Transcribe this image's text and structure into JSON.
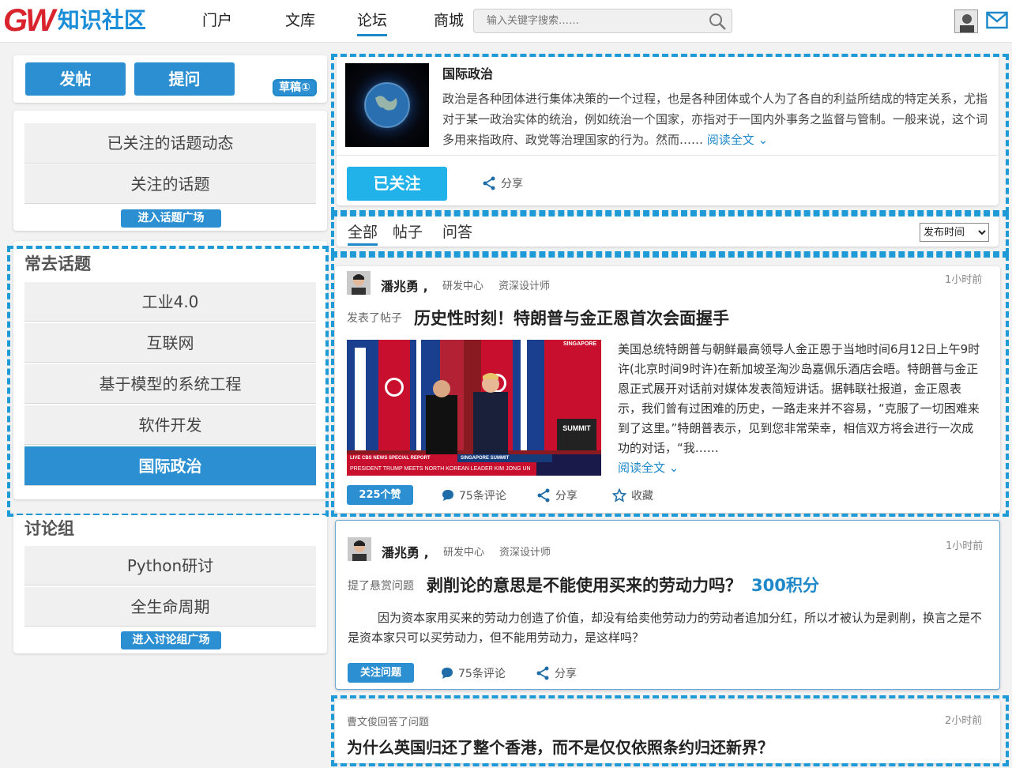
{
  "header": {
    "logo_mark": "GW",
    "logo_text": "知识社区",
    "nav": [
      "门户",
      "文库",
      "论坛",
      "商城"
    ],
    "active_nav": 2,
    "search_placeholder": "输入关键字搜索……"
  },
  "sidebar": {
    "post_button": "发帖",
    "ask_button": "提问",
    "draft_label": "草稿①",
    "followed_items": [
      "已关注的话题动态",
      "关注的话题"
    ],
    "topic_square": "进入话题广场",
    "frequent_title": "常去话题",
    "frequent_items": [
      "工业4.0",
      "互联网",
      "基于模型的系统工程",
      "软件开发",
      "国际政治"
    ],
    "active_frequent": 4,
    "groups_title": "讨论组",
    "group_items": [
      "Python研讨",
      "全生命周期"
    ],
    "group_square": "进入讨论组广场"
  },
  "topic": {
    "title": "国际政治",
    "description": "政治是各种团体进行集体决策的一个过程，也是各种团体或个人为了各自的利益所结成的特定关系，尤指对于某一政治实体的统治，例如统治一个国家，亦指对于一国内外事务之监督与管制。一般来说，这个词多用来指政府、政党等治理国家的行为。然而……",
    "read_more": "阅读全文",
    "followed_button": "已关注",
    "share": "分享"
  },
  "tabs": [
    "全部",
    "帖子",
    "问答"
  ],
  "active_tab": 0,
  "sort": {
    "selected": "发布时间"
  },
  "feed": {
    "post1": {
      "author": "潘兆勇",
      "dept": "研发中心",
      "role": "资深设计师",
      "time": "1小时前",
      "action": "发表了帖子",
      "title": "历史性时刻！特朗普与金正恩首次会面握手",
      "body": "美国总统特朗普与朝鲜最高领导人金正恩于当地时间6月12日上午9时许(北京时间9时许)在新加坡圣淘沙岛嘉佩乐酒店会晤。特朗普与金正恩正式展开对话前对媒体发表简短讲话。据韩联社报道，金正恩表示，我们曾有过困难的历史，一路走来并不容易，“克服了一切困难来到了这里。”特朗普表示，见到您非常荣幸，相信双方将会进行一次成功的对话，“我……",
      "read_more": "阅读全文",
      "image_banner_top": "SINGAPORE",
      "image_banner_live": "LIVE  CBS NEWS  SPECIAL REPORT",
      "image_banner_summit": "SINGAPORE SUMMIT",
      "image_caption": "PRESIDENT TRUMP MEETS NORTH KOREAN LEADER KIM JONG UN",
      "image_corner": "SUMMIT",
      "likes": "225个赞",
      "comments": "75条评论",
      "share": "分享",
      "favorite": "收藏"
    },
    "post2": {
      "author": "潘兆勇",
      "dept": "研发中心",
      "role": "资深设计师",
      "time": "1小时前",
      "action": "提了悬赏问题",
      "title": "剥削论的意思是不能使用买来的劳动力吗？",
      "points": "300积分",
      "body": "因为资本家用买来的劳动力创造了价值，却没有给卖他劳动力的劳动者追加分红，所以才被认为是剥削，换言之是不是资本家只可以买劳动力，但不能用劳动力，是这样吗？",
      "follow_button": "关注问题",
      "comments": "75条评论",
      "share": "分享"
    },
    "post3": {
      "action": "曹文俊回答了问题",
      "time": "2小时前",
      "title": "为什么英国归还了整个香港，而不是仅仅依照条约归还新界？"
    }
  }
}
